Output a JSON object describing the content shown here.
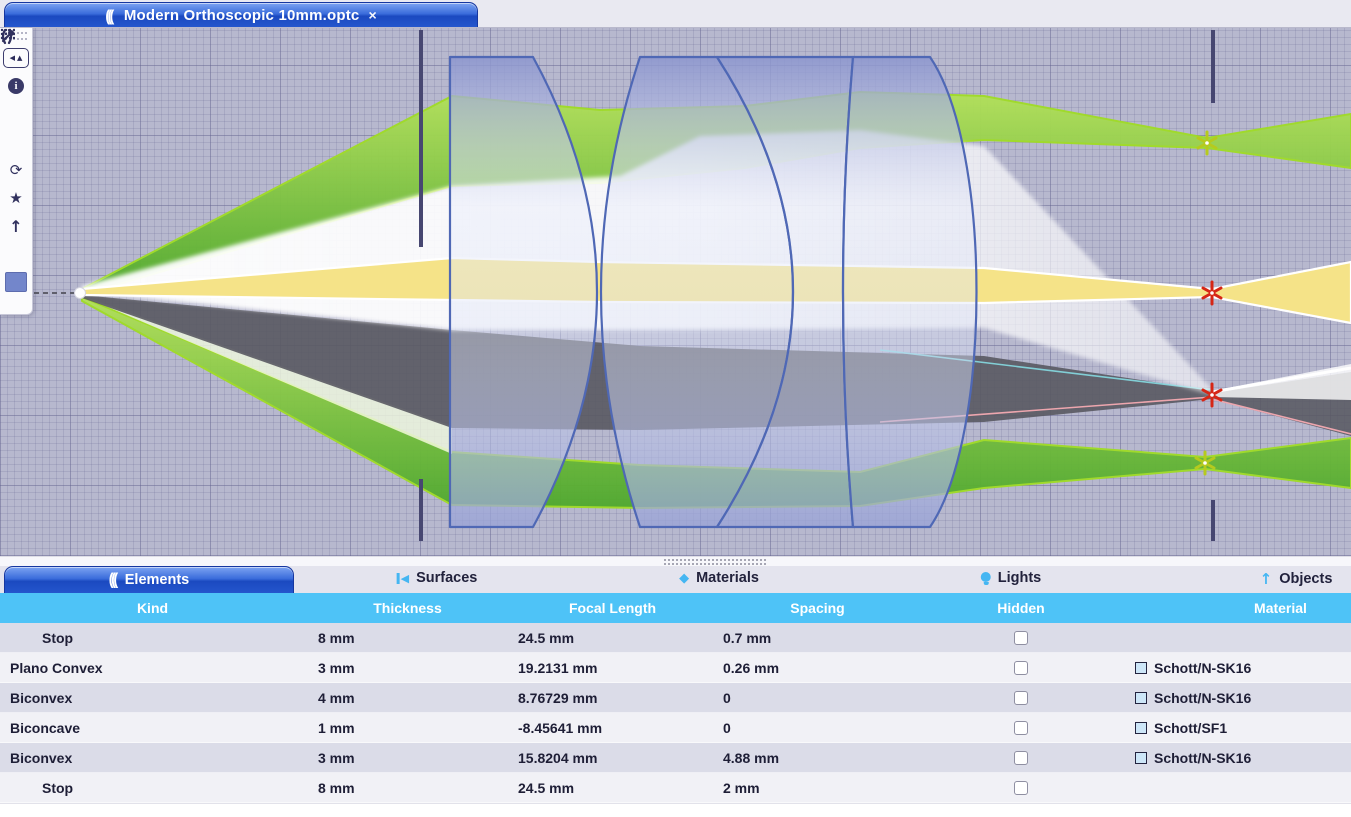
{
  "window": {
    "doc_tab": {
      "title": "Modern Orthoscopic 10mm.optc",
      "close": "×",
      "icon": "lens-icon"
    }
  },
  "toolbar": {
    "items": [
      {
        "name": "drag-handle"
      },
      {
        "name": "nav-buttons",
        "glyphs": "◀ ▲"
      },
      {
        "name": "info-icon"
      },
      {
        "name": "grid-icon"
      },
      {
        "name": "lens-icon"
      },
      {
        "name": "refresh-icon",
        "glyph": "⟳"
      },
      {
        "name": "star-icon",
        "glyph": "★"
      },
      {
        "name": "up-arrow-icon",
        "glyph": "↑"
      },
      {
        "name": "eyedropper-icon"
      },
      {
        "name": "color-swatch",
        "color": "#7386cb"
      }
    ]
  },
  "panels": {
    "tabs": [
      {
        "label": "Elements",
        "icon": "lens-icon",
        "active": true
      },
      {
        "label": "Surfaces",
        "icon": "surfaces-icon",
        "active": false
      },
      {
        "label": "Materials",
        "icon": "gem-icon",
        "active": false
      },
      {
        "label": "Lights",
        "icon": "bulb-icon",
        "active": false
      },
      {
        "label": "Objects",
        "icon": "up-arrow-icon",
        "active": false
      }
    ]
  },
  "table": {
    "columns": [
      "Kind",
      "Thickness",
      "Focal Length",
      "Spacing",
      "Hidden",
      "Material"
    ],
    "rows": [
      {
        "kind": "Stop",
        "indent": true,
        "thickness": "8 mm",
        "focal_length": "24.5 mm",
        "spacing": "0.7 mm",
        "hidden": false,
        "material": null
      },
      {
        "kind": "Plano Convex",
        "indent": false,
        "thickness": "3 mm",
        "focal_length": "19.2131 mm",
        "spacing": "0.26 mm",
        "hidden": false,
        "material": "Schott/N-SK16"
      },
      {
        "kind": "Biconvex",
        "indent": false,
        "thickness": "4 mm",
        "focal_length": "8.76729 mm",
        "spacing": "0",
        "hidden": false,
        "material": "Schott/N-SK16"
      },
      {
        "kind": "Biconcave",
        "indent": false,
        "thickness": "1 mm",
        "focal_length": "-8.45641 mm",
        "spacing": "0",
        "hidden": false,
        "material": "Schott/SF1"
      },
      {
        "kind": "Biconvex",
        "indent": false,
        "thickness": "3 mm",
        "focal_length": "15.8204 mm",
        "spacing": "4.88 mm",
        "hidden": false,
        "material": "Schott/N-SK16"
      },
      {
        "kind": "Stop",
        "indent": true,
        "thickness": "8 mm",
        "focal_length": "24.5 mm",
        "spacing": "2 mm",
        "hidden": false,
        "material": null
      }
    ]
  },
  "colors": {
    "header_cyan": "#4ec3f7",
    "icon_blue": "#45b6f2",
    "row_odd": "#dbdce8",
    "row_even": "#f1f1f6",
    "material_swatch": "#cde6f8",
    "viewport_bg": "#b7b8ce",
    "lens_outline": "#4f68b5",
    "ray_green": "#6fc23e",
    "ray_yellow": "#f5e388",
    "ray_dark": "#595962",
    "focus_red": "#d62615",
    "focus_green": "#b6ca1e",
    "stop_line": "#474771",
    "tab_blue_top": "#7da4f2",
    "tab_blue_bottom": "#1b49c0"
  }
}
